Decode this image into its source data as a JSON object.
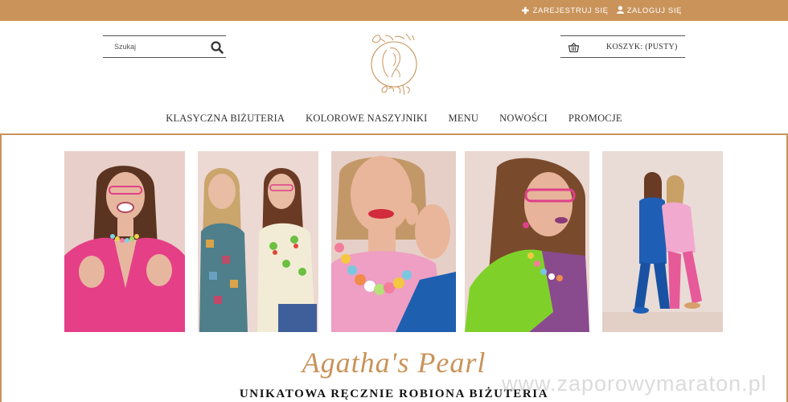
{
  "topbar": {
    "register_label": "ZAREJESTRUJ SIĘ",
    "login_label": "ZALOGUJ SIĘ",
    "register_icon": "plus-icon",
    "login_icon": "user-icon",
    "background_color": "#c9935a"
  },
  "search": {
    "placeholder": "Szukaj",
    "icon": "search-icon"
  },
  "logo": {
    "name": "Agatha's Pearl"
  },
  "cart": {
    "label": "KOSZYK: (PUSTY)",
    "icon": "basket-icon"
  },
  "nav": {
    "items": [
      {
        "label": "KLASYCZNA BIŻUTERIA"
      },
      {
        "label": "KOLOROWE NASZYJNIKI"
      },
      {
        "label": "MENU"
      },
      {
        "label": "NOWOŚCI"
      },
      {
        "label": "PROMOCJE"
      }
    ]
  },
  "hero": {
    "title": "Agatha's Pearl",
    "tagline": "UNIKATOWA RĘCZNIE ROBIONA BIŻUTERIA",
    "accent_color": "#c9935a"
  },
  "watermark": "www.zaporowymaraton.pl"
}
